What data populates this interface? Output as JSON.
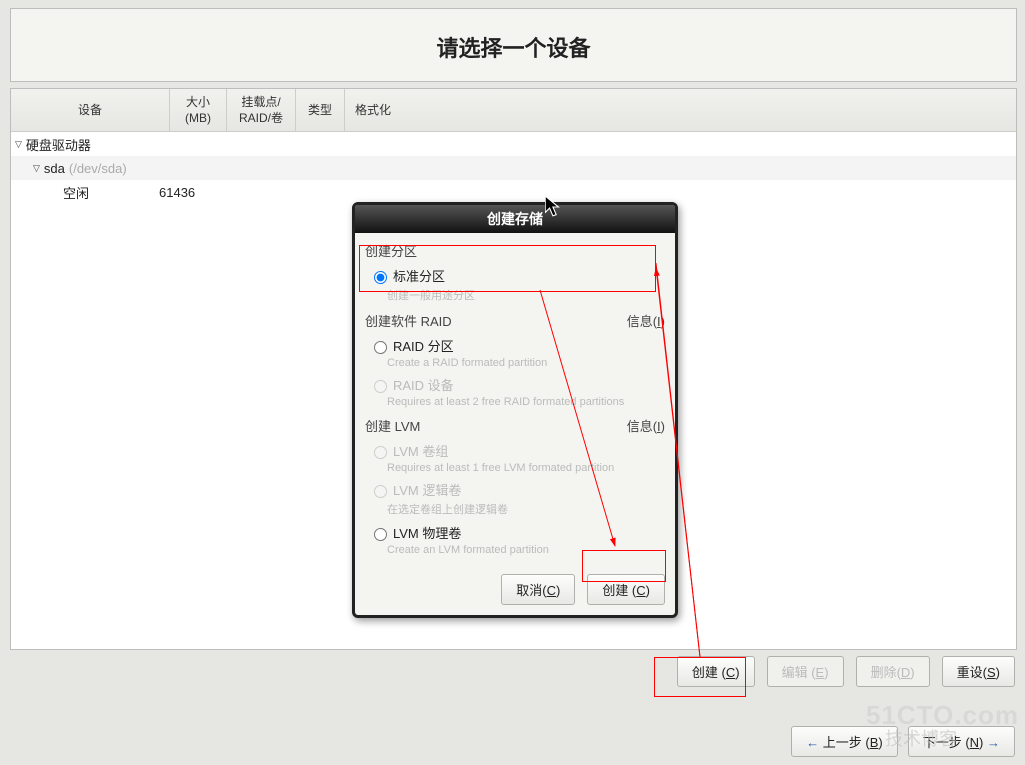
{
  "title": "请选择一个设备",
  "headers": {
    "device": "设备",
    "size": "大小\n(MB)",
    "mount": "挂载点/\nRAID/卷",
    "type": "类型",
    "format": "格式化"
  },
  "tree": {
    "root": "硬盘驱动器",
    "disk": "sda",
    "disk_dev": "(/dev/sda)",
    "free_label": "空闲",
    "free_size": "61436"
  },
  "modal": {
    "title": "创建存储",
    "section_partition": "创建分区",
    "standard_partition": "标准分区",
    "standard_hint": "创建一般用途分区",
    "section_raid": "创建软件 RAID",
    "info_raid": "信息(I)",
    "raid_partition": "RAID 分区",
    "raid_partition_hint": "Create a RAID formated partition",
    "raid_device": "RAID 设备",
    "raid_device_hint": "Requires at least 2 free RAID formated partitions",
    "section_lvm": "创建 LVM",
    "info_lvm": "信息(I)",
    "lvm_vg": "LVM 卷组",
    "lvm_vg_hint": "Requires at least 1 free LVM formated partition",
    "lvm_lv": "LVM 逻辑卷",
    "lvm_lv_hint": "在选定卷组上创建逻辑卷",
    "lvm_pv": "LVM 物理卷",
    "lvm_pv_hint": "Create an LVM formated partition",
    "cancel": "取消(C)",
    "create": "创建 (C)"
  },
  "footer": {
    "create": "创建 (C)",
    "edit": "编辑 (E)",
    "delete": "删除(D)",
    "reset": "重设(S)"
  },
  "nav": {
    "back": "上一步 (B)",
    "next": "下一步 (N)"
  },
  "watermark": "51CTO.com",
  "watermark2": "技术博客"
}
